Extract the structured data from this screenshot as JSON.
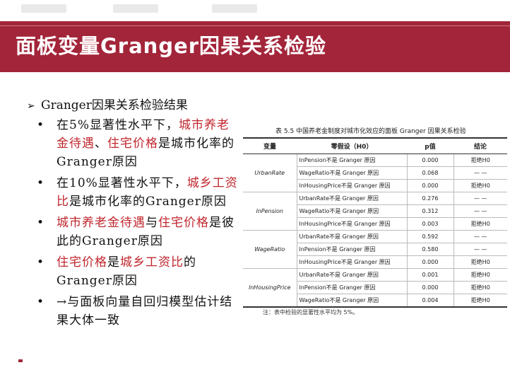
{
  "slide": {
    "title": "面板变量Granger因果关系检验",
    "heading": "Granger因果关系检验结果",
    "heading_bullet": "➢",
    "bullet_char": "•",
    "bullets": [
      [
        {
          "text": "在5%显著性水平下，",
          "red": false
        },
        {
          "text": "城市养老金待遇",
          "red": true
        },
        {
          "text": "、",
          "red": false
        },
        {
          "text": "住宅价格",
          "red": true
        },
        {
          "text": "是城市化率的Granger原因",
          "red": false
        }
      ],
      [
        {
          "text": "在10%显著性水平下，",
          "red": false
        },
        {
          "text": "城乡工资比",
          "red": true
        },
        {
          "text": "是城市化率的Granger原因",
          "red": false
        }
      ],
      [
        {
          "text": "城市养老金待遇",
          "red": true
        },
        {
          "text": "与",
          "red": false
        },
        {
          "text": "住宅价格",
          "red": true
        },
        {
          "text": "是彼此的Granger原因",
          "red": false
        }
      ],
      [
        {
          "text": "住宅价格",
          "red": true
        },
        {
          "text": "是",
          "red": false
        },
        {
          "text": "城乡工资比",
          "red": true
        },
        {
          "text": "的Granger原因",
          "red": false
        }
      ],
      [
        {
          "text": "→与面板向量自回归模型估计结果大体一致",
          "red": false
        }
      ]
    ]
  },
  "table": {
    "caption": "表 5.5  中国养老金制度对城市化效应的面板 Granger 因果关系检验",
    "headers": [
      "变量",
      "零假设（H0）",
      "p值",
      "结论"
    ],
    "groups": [
      {
        "variable": "UrbanRate",
        "rows": [
          {
            "hypothesis": "lnPension不是 Granger 原因",
            "p": "0.000",
            "conclusion": "拒绝H0"
          },
          {
            "hypothesis": "WageRatio不是 Granger 原因",
            "p": "0.068",
            "conclusion": "— —"
          },
          {
            "hypothesis": "lnHousingPrice不是 Granger 原因",
            "p": "0.000",
            "conclusion": "拒绝H0"
          }
        ]
      },
      {
        "variable": "lnPension",
        "rows": [
          {
            "hypothesis": "UrbanRate不是 Granger 原因",
            "p": "0.276",
            "conclusion": "— —"
          },
          {
            "hypothesis": "WageRatio不是 Granger 原因",
            "p": "0.312",
            "conclusion": "— —"
          },
          {
            "hypothesis": "lnHousingPrice不是 Granger 原因",
            "p": "0.003",
            "conclusion": "拒绝H0"
          }
        ]
      },
      {
        "variable": "WageRatio",
        "rows": [
          {
            "hypothesis": "UrbanRate不是 Granger 原因",
            "p": "0.592",
            "conclusion": "— —"
          },
          {
            "hypothesis": "lnPension不是 Granger 原因",
            "p": "0.580",
            "conclusion": "— —"
          },
          {
            "hypothesis": "lnHousingPrice不是 Granger 原因",
            "p": "0.000",
            "conclusion": "拒绝H0"
          }
        ]
      },
      {
        "variable": "lnHousingPrice",
        "rows": [
          {
            "hypothesis": "UrbanRate不是 Granger 原因",
            "p": "0.001",
            "conclusion": "拒绝H0"
          },
          {
            "hypothesis": "lnPension不是 Granger 原因",
            "p": "0.000",
            "conclusion": "拒绝H0"
          },
          {
            "hypothesis": "WageRatio不是 Granger 原因",
            "p": "0.004",
            "conclusion": "拒绝H0"
          }
        ]
      }
    ],
    "note": "注：表中检验的显著性水平均为 5%。"
  },
  "colors": {
    "title_bar": "#a3253a",
    "highlight": "#c0262d",
    "text": "#111111"
  }
}
